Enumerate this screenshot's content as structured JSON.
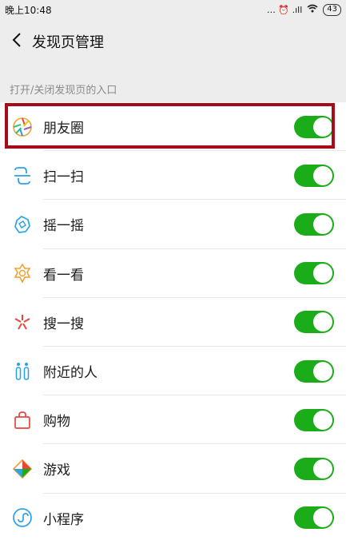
{
  "status_bar": {
    "time": "晚上10:48",
    "indicators": "… ⏰ .ıll",
    "battery": "43"
  },
  "header": {
    "back_icon": "chevron-left-icon",
    "title": "发现页管理"
  },
  "section_label": "打开/关闭发现页的入口",
  "colors": {
    "toggle_on": "#1aad19",
    "highlight_border": "#a50b19",
    "background": "#ededed"
  },
  "items": [
    {
      "label": "朋友圈",
      "icon": "moments-icon",
      "enabled": true,
      "highlighted": true
    },
    {
      "label": "扫一扫",
      "icon": "scan-icon",
      "enabled": true
    },
    {
      "label": "摇一摇",
      "icon": "shake-icon",
      "enabled": true
    },
    {
      "label": "看一看",
      "icon": "top-stories-icon",
      "enabled": true
    },
    {
      "label": "搜一搜",
      "icon": "search-icon",
      "enabled": true
    },
    {
      "label": "附近的人",
      "icon": "people-nearby-icon",
      "enabled": true
    },
    {
      "label": "购物",
      "icon": "shopping-bag-icon",
      "enabled": true
    },
    {
      "label": "游戏",
      "icon": "games-icon",
      "enabled": true
    },
    {
      "label": "小程序",
      "icon": "mini-programs-icon",
      "enabled": true
    }
  ]
}
